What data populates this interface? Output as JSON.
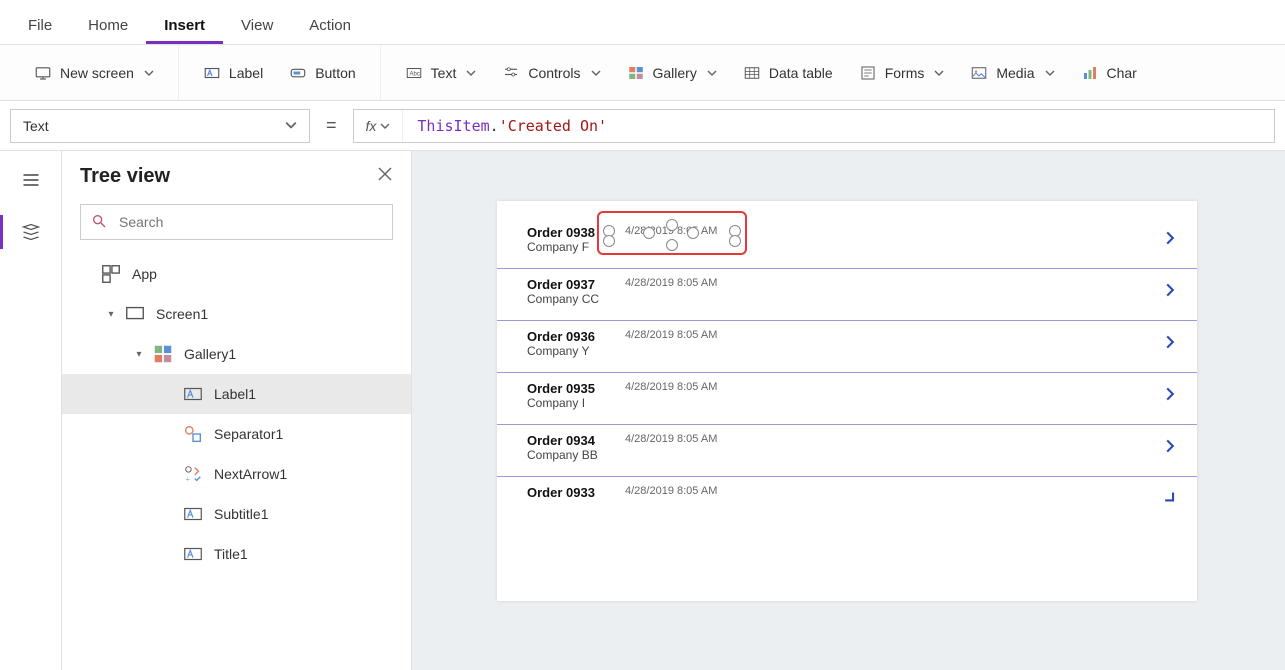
{
  "menu": {
    "file": "File",
    "home": "Home",
    "insert": "Insert",
    "view": "View",
    "action": "Action",
    "active": "insert"
  },
  "ribbon": {
    "new_screen": "New screen",
    "label": "Label",
    "button": "Button",
    "text": "Text",
    "controls": "Controls",
    "gallery": "Gallery",
    "data_table": "Data table",
    "forms": "Forms",
    "media": "Media",
    "charts": "Char"
  },
  "property_selector": "Text",
  "formula": {
    "this": "ThisItem",
    "dot": ".",
    "str": "'Created On'"
  },
  "tree": {
    "title": "Tree view",
    "search_placeholder": "Search",
    "nodes": {
      "app": "App",
      "screen1": "Screen1",
      "gallery1": "Gallery1",
      "label1": "Label1",
      "separator1": "Separator1",
      "nextarrow1": "NextArrow1",
      "subtitle1": "Subtitle1",
      "title1": "Title1"
    },
    "selected": "label1"
  },
  "gallery_items": [
    {
      "title": "Order 0938",
      "subtitle": "Company F",
      "date": "4/28/2019 8:05 AM"
    },
    {
      "title": "Order 0937",
      "subtitle": "Company CC",
      "date": "4/28/2019 8:05 AM"
    },
    {
      "title": "Order 0936",
      "subtitle": "Company Y",
      "date": "4/28/2019 8:05 AM"
    },
    {
      "title": "Order 0935",
      "subtitle": "Company I",
      "date": "4/28/2019 8:05 AM"
    },
    {
      "title": "Order 0934",
      "subtitle": "Company BB",
      "date": "4/28/2019 8:05 AM"
    },
    {
      "title": "Order 0933",
      "subtitle": "",
      "date": "4/28/2019 8:05 AM"
    }
  ],
  "colors": {
    "accent": "#7b2fbf",
    "selection": "#e53935",
    "arrow": "#2b4ab5"
  }
}
